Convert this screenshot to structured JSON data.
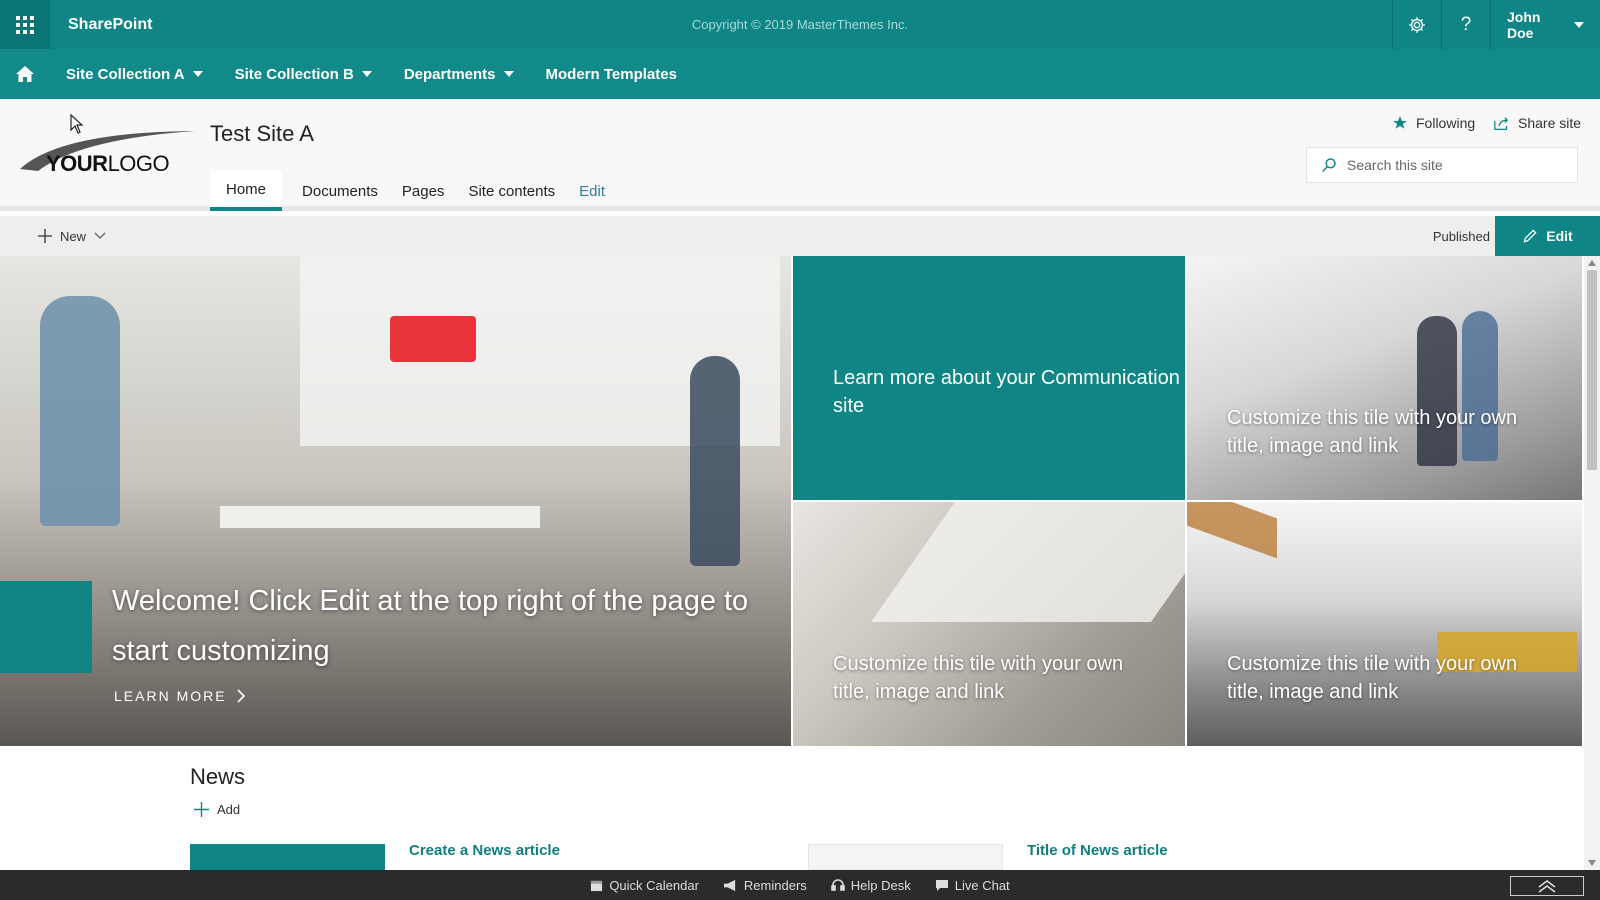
{
  "suite": {
    "brand": "SharePoint",
    "copyright": "Copyright © 2019 MasterThemes Inc.",
    "user": "John Doe"
  },
  "mega_nav": {
    "items": [
      {
        "label": "Site Collection A"
      },
      {
        "label": "Site Collection B"
      },
      {
        "label": "Departments"
      },
      {
        "label": "Modern Templates"
      }
    ]
  },
  "header": {
    "logo_bold": "YOUR",
    "logo_rest": "LOGO",
    "site_title": "Test Site A",
    "nav": [
      {
        "label": "Home"
      },
      {
        "label": "Documents"
      },
      {
        "label": "Pages"
      },
      {
        "label": "Site contents"
      },
      {
        "label": "Edit"
      }
    ],
    "following": "Following",
    "share": "Share site",
    "search_placeholder": "Search this site"
  },
  "commandbar": {
    "new": "New",
    "status": "Published",
    "edit": "Edit"
  },
  "hero": {
    "main_title": "Welcome! Click Edit at the top right of the page to start customizing",
    "learn_more": "LEARN MORE",
    "teal_tile": "Learn more about your Communication site",
    "tile_1": "Customize this tile with your own title, image and link",
    "tile_2": "Customize this tile with your own title, image and link",
    "tile_3": "Customize this tile with your own title, image and link"
  },
  "news": {
    "title": "News",
    "add": "Add",
    "article_1": "Create a News article",
    "article_2": "Title of News article"
  },
  "bottom_bar": {
    "items": [
      {
        "label": "Quick Calendar",
        "icon": "calendar-icon"
      },
      {
        "label": "Reminders",
        "icon": "megaphone-icon"
      },
      {
        "label": "Help Desk",
        "icon": "headset-icon"
      },
      {
        "label": "Live Chat",
        "icon": "chat-icon"
      }
    ]
  },
  "colors": {
    "brand": "#0f8585",
    "brand_dark": "#0b7575",
    "bottom_bar": "#2b2b2b"
  }
}
